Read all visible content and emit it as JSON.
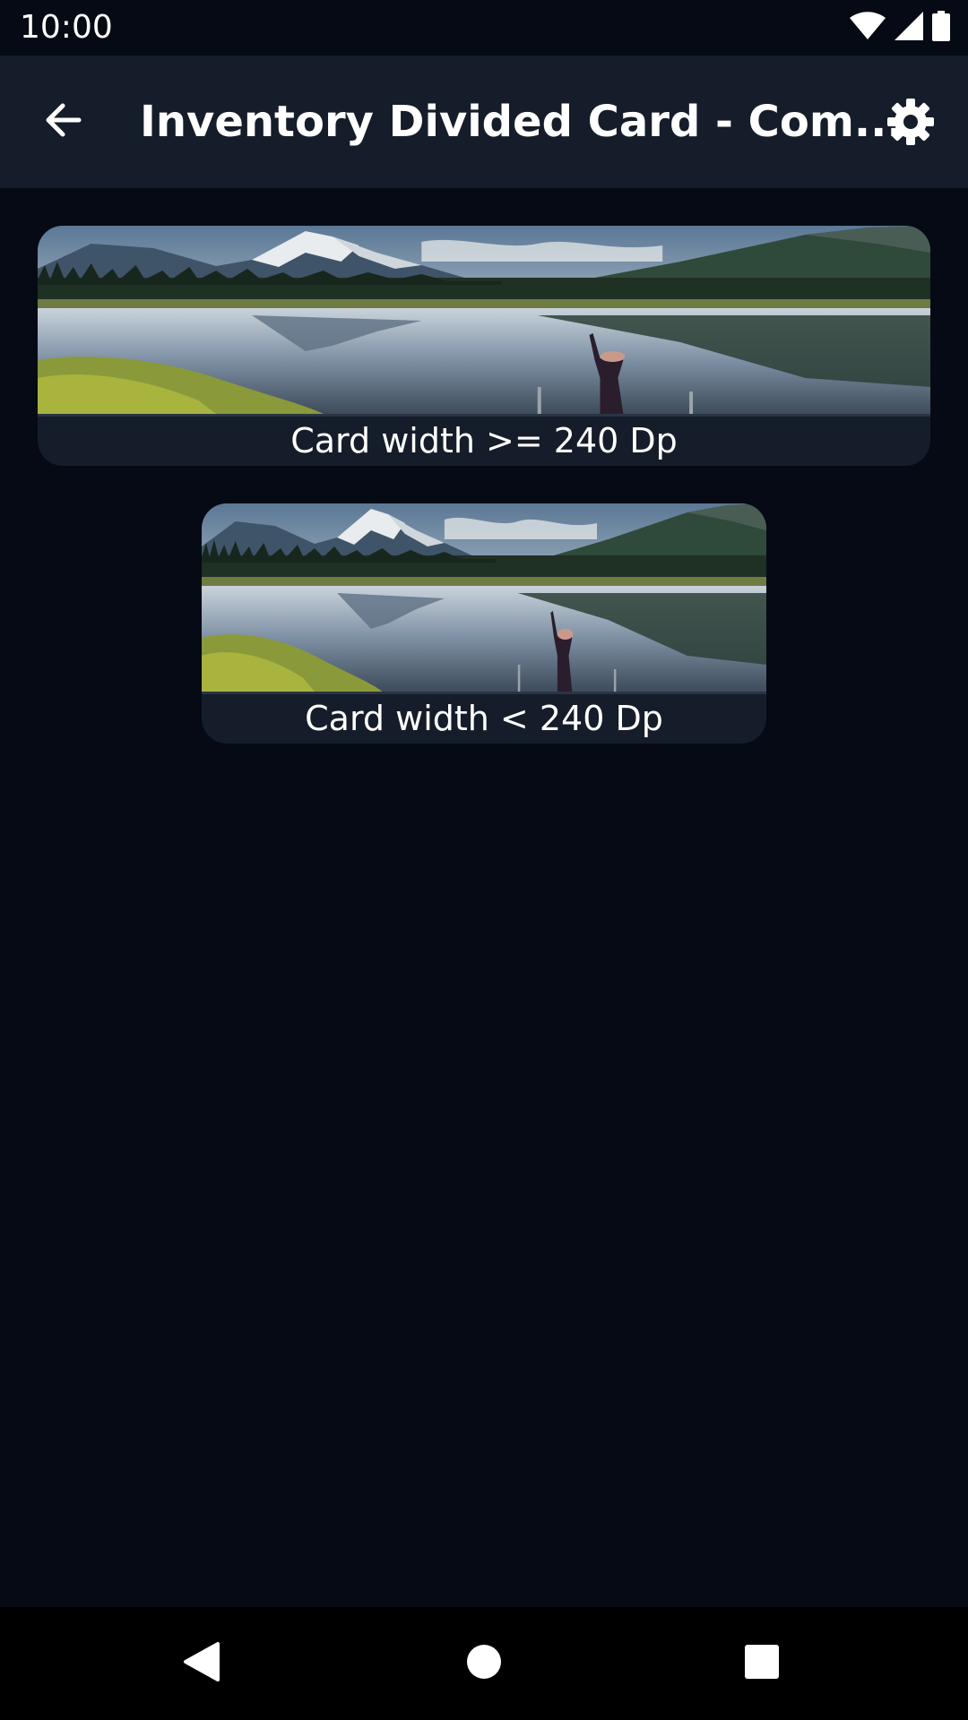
{
  "status_bar": {
    "time": "10:00",
    "icons": [
      "wifi-icon",
      "cell-signal-icon",
      "battery-icon"
    ]
  },
  "app_bar": {
    "title": "Inventory Divided Card - Com...",
    "back_icon": "arrow-back-icon",
    "settings_icon": "gear-icon",
    "background": "#151d2a"
  },
  "cards": [
    {
      "label": "Card width >= 240 Dp",
      "image": "lake-mountain-landscape"
    },
    {
      "label": "Card width < 240 Dp",
      "image": "lake-mountain-landscape"
    }
  ],
  "nav_bar": {
    "back_icon": "triangle-back-icon",
    "home_icon": "circle-home-icon",
    "recents_icon": "square-recents-icon"
  },
  "colors": {
    "page_background": "#050a14",
    "card_background": "#151d2a",
    "text": "#ffffff"
  }
}
